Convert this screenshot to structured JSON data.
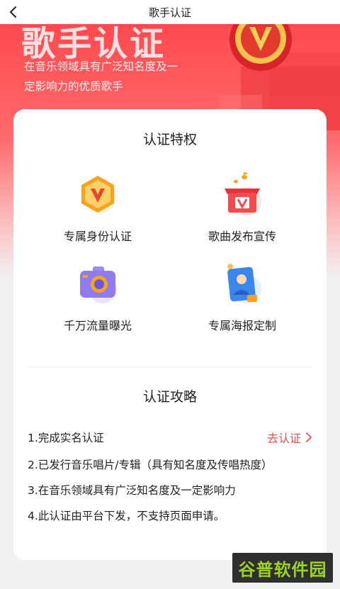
{
  "nav": {
    "title": "歌手认证",
    "back_icon": "chevron-left-icon"
  },
  "hero": {
    "title": "歌手认证",
    "description": "在音乐领域具有广泛知名度及一定影响力的优质歌手"
  },
  "privileges": {
    "title": "认证特权",
    "items": [
      {
        "label": "专属身份认证",
        "icon": "v-badge-icon"
      },
      {
        "label": "歌曲发布宣传",
        "icon": "gift-box-icon"
      },
      {
        "label": "千万流量曝光",
        "icon": "camera-icon"
      },
      {
        "label": "专属海报定制",
        "icon": "poster-icon"
      }
    ]
  },
  "guide": {
    "title": "认证攻略",
    "steps": [
      "1.完成实名认证",
      "2.已发行音乐唱片/专辑（具有知名度及传唱热度）",
      "3.在音乐领域具有广泛知名度及一定影响力",
      "4.此认证由平台下发，不支持页面申请。"
    ],
    "action_label": "去认证"
  },
  "watermark": "谷普软件园",
  "colors": {
    "accent": "#f34b4e",
    "hero_top": "#ff4a4f",
    "watermark_text": "#9bd322"
  }
}
